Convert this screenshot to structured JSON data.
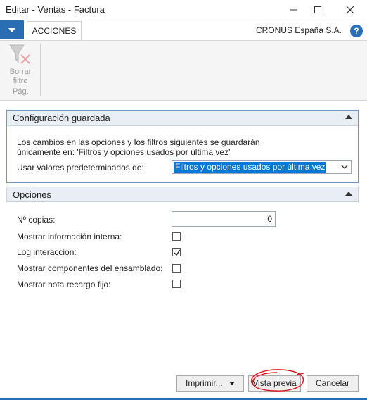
{
  "window": {
    "title": "Editar - Ventas - Factura"
  },
  "ribbon": {
    "tab_label": "ACCIONES",
    "company": "CRONUS España S.A.",
    "help_label": "?",
    "clear_filter_label_1": "Borrar",
    "clear_filter_label_2": "filtro",
    "group_label": "Pág."
  },
  "saved_config": {
    "header": "Configuración guardada",
    "description_line1": "Los cambios en las opciones y los filtros siguientes se guardarán",
    "description_line2": "únicamente en: 'Filtros y opciones usados por última vez'",
    "defaults_label": "Usar valores predeterminados de:",
    "defaults_value": "Filtros y opciones usados por última vez"
  },
  "options": {
    "header": "Opciones",
    "copies_label": "Nº copias:",
    "copies_value": "0",
    "internal_info_label": "Mostrar información interna:",
    "internal_info_checked": false,
    "log_label": "Log interacción:",
    "log_checked": true,
    "assembly_label": "Mostrar componentes del ensamblado:",
    "assembly_checked": false,
    "fixed_surcharge_label": "Mostrar nota recargo fijo:",
    "fixed_surcharge_checked": false
  },
  "buttons": {
    "print": "Imprimir...",
    "preview": "Vista previa",
    "cancel": "Cancelar"
  },
  "colors": {
    "accent": "#2b6db3",
    "annotation": "#e0131b"
  }
}
